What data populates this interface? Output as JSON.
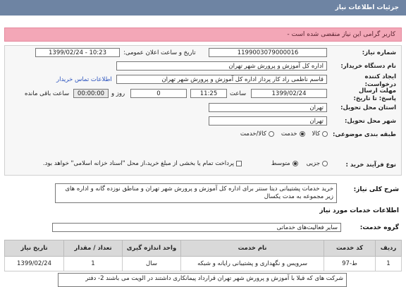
{
  "header": {
    "title": "جزئیات اطلاعات نیاز"
  },
  "alert": {
    "text": "- کاربر گرامی این نیاز منقضی شده است"
  },
  "form": {
    "need_number_label": "شماره نیاز:",
    "need_number": "1199003079000016",
    "announce_label": "تاریخ و ساعت اعلان عمومی:",
    "announce_value": "1399/02/24 - 10:23",
    "buyer_label": "نام دستگاه خریدار:",
    "buyer_value": "اداره کل آموزش و پرورش شهر تهران",
    "creator_label": "ایجاد کننده درخواست:",
    "creator_value": "قاسم ناظمی راد کار پرداز  اداره کل آموزش و پرورش شهر تهران",
    "contact_link": "اطلاعات تماس خریدار",
    "deadline_label": "مهلت ارسال پاسخ: تا تاریخ:",
    "deadline_date": "1399/02/24",
    "time_label": "ساعت",
    "deadline_time": "11:25",
    "days_value": "0",
    "days_label": "روز و",
    "remaining_time": "00:00:00",
    "remaining_label": "ساعت باقی مانده",
    "province_label": "استان محل تحویل:",
    "province_value": "تهران",
    "city_label": "شهر محل تحویل:",
    "city_value": "تهران",
    "category_label": "طبقه بندی موضوعی:",
    "category_options": [
      "کالا",
      "خدمت",
      "کالا/خدمت"
    ],
    "category_selected": 1,
    "process_label": "نوع فرآیند خرید :",
    "process_options": [
      "جزیی",
      "متوسط"
    ],
    "process_selected": 1,
    "payment_note": "پرداخت تمام یا بخشی از مبلغ خرید،از محل \"اسناد خزانه اسلامی\" خواهد بود."
  },
  "description": {
    "label": "شرح کلی نیاز:",
    "text": "خرید خدمات پشتیبانی دیتا سنتر برای اداره کل آموزش و پرورش شهر تهران و مناطق نوزده گانه و اداره های زیر مجموعه به مدت یکسال"
  },
  "services": {
    "section_title": "اطلاعات خدمات مورد نیاز",
    "group_label": "گروه خدمت:",
    "group_value": "سایر فعالیت‌های خدماتی",
    "columns": [
      "ردیف",
      "کد خدمت",
      "نام خدمت",
      "واحد اندازه گیری",
      "تعداد / مقدار",
      "تاریخ نیاز"
    ],
    "rows": [
      [
        "1",
        "ط-97",
        "سرویس و نگهداری و پشتیبانی رایانه و شبکه",
        "سال",
        "1",
        "1399/02/24"
      ]
    ]
  },
  "note": {
    "text": "شرکت های که قبلا با آموزش و پرورش شهر تهران قرارداد پیمانکاری داشتند در الویت می باشند 2- دفتر"
  }
}
